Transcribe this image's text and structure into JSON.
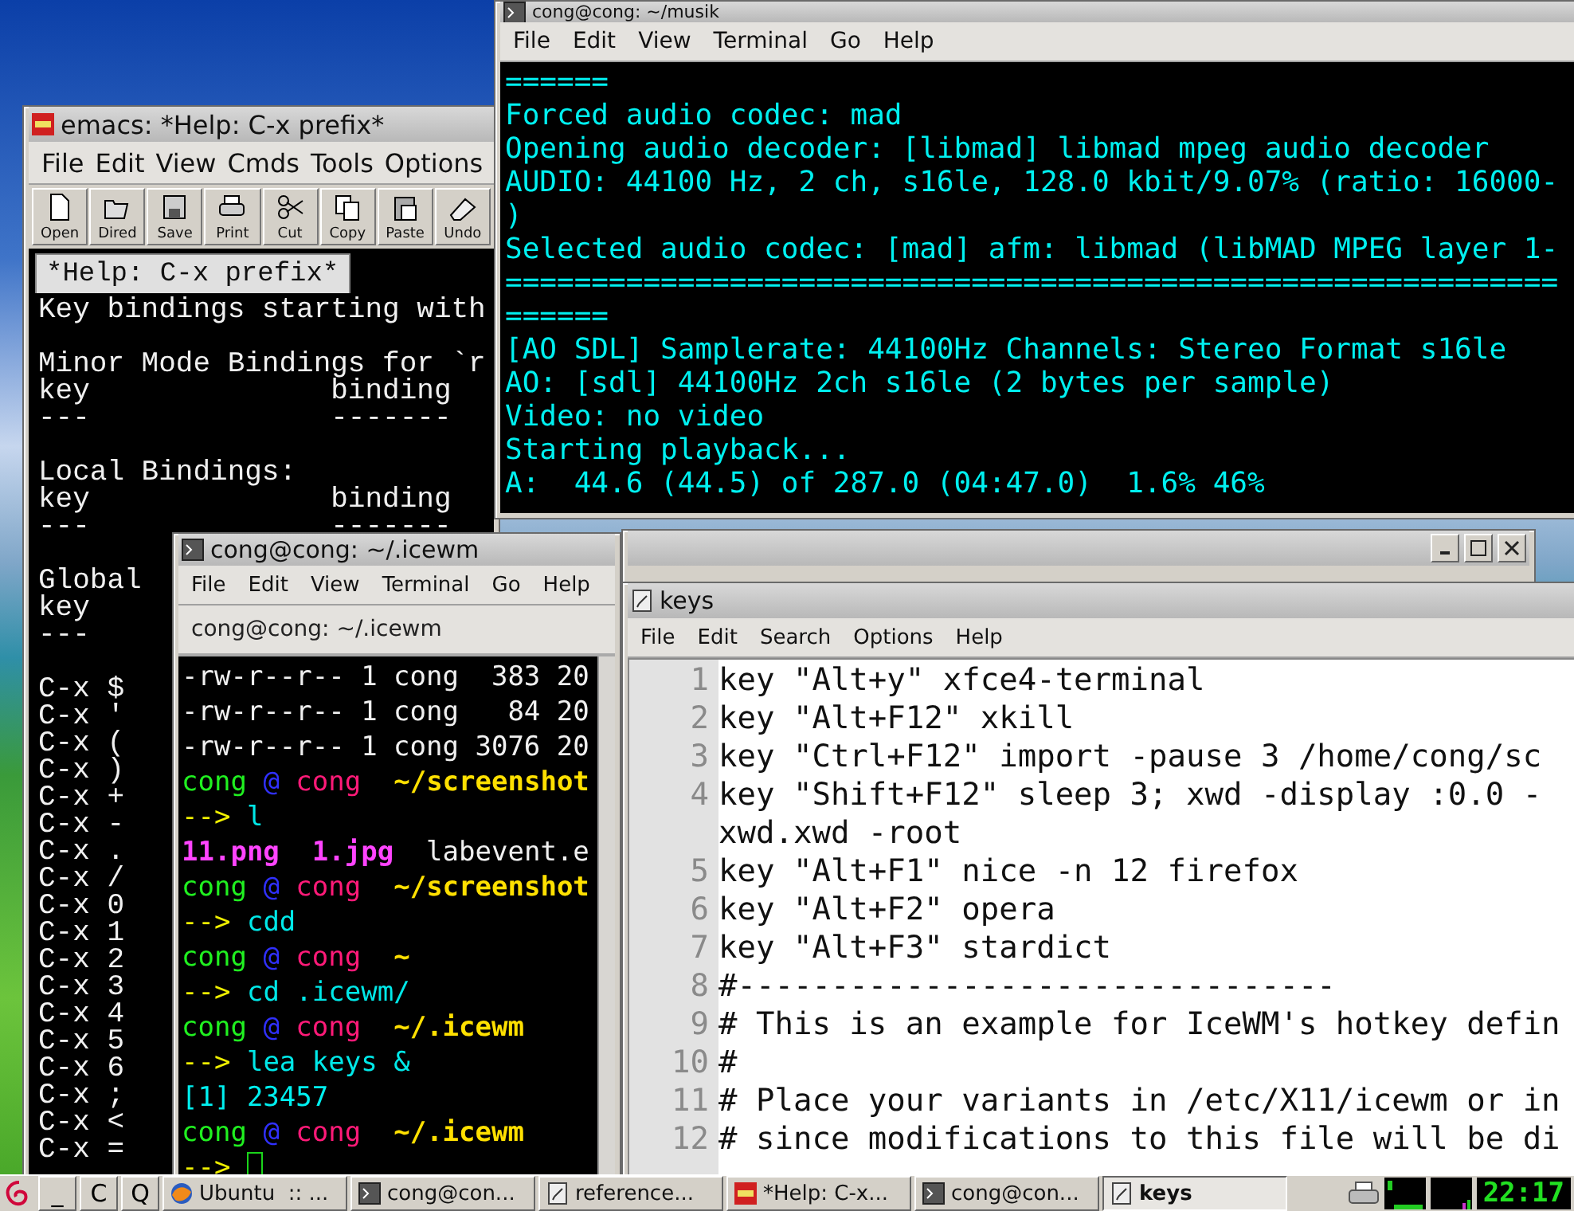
{
  "emacs_window": {
    "title": "emacs: *Help: C-x prefix*",
    "menu": [
      "File",
      "Edit",
      "View",
      "Cmds",
      "Tools",
      "Options"
    ],
    "toolbar": [
      "Open",
      "Dired",
      "Save",
      "Print",
      "Cut",
      "Copy",
      "Paste",
      "Undo"
    ],
    "tab": "*Help: C-x prefix*",
    "blocks": [
      [
        "Key bindings starting with"
      ],
      [
        "Minor Mode Bindings for `r",
        "key              binding",
        "---              -------"
      ],
      [
        "Local Bindings:",
        "key              binding",
        "---              -------"
      ],
      [
        "Global",
        "key",
        "---"
      ],
      [
        "C-x $",
        "C-x '",
        "C-x (",
        "C-x )",
        "C-x +",
        "C-x -",
        "C-x .",
        "C-x /",
        "C-x 0",
        "C-x 1",
        "C-x 2",
        "C-x 3",
        "C-x 4",
        "C-x 5",
        "C-x 6",
        "C-x ;",
        "C-x <",
        "C-x ="
      ]
    ]
  },
  "music_terminal": {
    "title": "cong@cong: ~/musik",
    "menu": [
      "File",
      "Edit",
      "View",
      "Terminal",
      "Go",
      "Help"
    ],
    "lines": [
      "======",
      "Forced audio codec: mad",
      "Opening audio decoder: [libmad] libmad mpeg audio decoder",
      "AUDIO: 44100 Hz, 2 ch, s16le, 128.0 kbit/9.07% (ratio: 16000-",
      ")",
      "Selected audio codec: [mad] afm: libmad (libMAD MPEG layer 1-",
      "=============================================================",
      "======",
      "[AO SDL] Samplerate: 44100Hz Channels: Stereo Format s16le",
      "AO: [sdl] 44100Hz 2ch s16le (2 bytes per sample)",
      "Video: no video",
      "Starting playback...",
      "A:  44.6 (44.5) of 287.0 (04:47.0)  1.6% 46%"
    ]
  },
  "icewm_terminal": {
    "title": "cong@cong: ~/.icewm",
    "menu": [
      "File",
      "Edit",
      "View",
      "Terminal",
      "Go",
      "Help"
    ],
    "tab": "cong@cong: ~/.icewm",
    "lines": [
      {
        "kind": "output",
        "text": "-rw-r--r-- 1 cong  383 20"
      },
      {
        "kind": "output",
        "text": "-rw-r--r-- 1 cong   84 20"
      },
      {
        "kind": "output",
        "text": "-rw-r--r-- 1 cong 3076 20"
      },
      {
        "kind": "prompt",
        "user": "cong",
        "at": "@",
        "host": "cong",
        "path": "~/screenshot"
      },
      {
        "kind": "command",
        "arrow": "-->",
        "command": "l"
      },
      {
        "kind": "files",
        "files": [
          {
            "text": "11.png",
            "kind": "image"
          },
          {
            "text": "1.jpg",
            "kind": "image"
          },
          {
            "text": "labevent.e",
            "kind": "plain"
          }
        ]
      },
      {
        "kind": "prompt",
        "user": "cong",
        "at": "@",
        "host": "cong",
        "path": "~/screenshot"
      },
      {
        "kind": "command",
        "arrow": "-->",
        "command": "cdd"
      },
      {
        "kind": "prompt",
        "user": "cong",
        "at": "@",
        "host": "cong",
        "path": "~"
      },
      {
        "kind": "command",
        "arrow": "-->",
        "command": "cd .icewm/"
      },
      {
        "kind": "prompt",
        "user": "cong",
        "at": "@",
        "host": "cong",
        "path": "~/.icewm"
      },
      {
        "kind": "command",
        "arrow": "-->",
        "command": "lea keys &"
      },
      {
        "kind": "job",
        "text": "[1] 23457"
      },
      {
        "kind": "prompt",
        "user": "cong",
        "at": "@",
        "host": "cong",
        "path": "~/.icewm"
      },
      {
        "kind": "command",
        "arrow": "-->",
        "cursor": true
      }
    ]
  },
  "editor_window": {
    "title": "keys",
    "menu": [
      "File",
      "Edit",
      "Search",
      "Options",
      "Help"
    ],
    "lines": [
      {
        "number": "1",
        "text": "key \"Alt+y\" xfce4-terminal"
      },
      {
        "number": "2",
        "text": "key \"Alt+F12\" xkill"
      },
      {
        "number": "3",
        "text": "key \"Ctrl+F12\" import -pause 3 /home/cong/sc"
      },
      {
        "number": "4",
        "text": "key \"Shift+F12\" sleep 3; xwd -display :0.0 -"
      },
      {
        "text": "xwd.xwd -root"
      },
      {
        "number": "5",
        "text": "key \"Alt+F1\" nice -n 12 firefox"
      },
      {
        "number": "6",
        "text": "key \"Alt+F2\" opera"
      },
      {
        "number": "7",
        "text": "key \"Alt+F3\" stardict"
      },
      {
        "number": "8",
        "text": "#--------------------------------"
      },
      {
        "number": "9",
        "text": "# This is an example for IceWM's hotkey defin"
      },
      {
        "number": "10",
        "text": "#"
      },
      {
        "number": "11",
        "text": "# Place your variants in /etc/X11/icewm or in"
      },
      {
        "number": "12",
        "text": "# since modifications to this file will be di"
      }
    ]
  },
  "taskbar": {
    "quick_buttons": [
      "_",
      "C",
      "Q"
    ],
    "tasks": [
      {
        "label": "Ubuntu  :: ...",
        "kind": "browser",
        "selected": false
      },
      {
        "label": "cong@con...",
        "kind": "terminal",
        "selected": false
      },
      {
        "label": "reference...",
        "kind": "editor",
        "selected": false
      },
      {
        "label": "*Help: C-x...",
        "kind": "emacs",
        "selected": false
      },
      {
        "label": "cong@con...",
        "kind": "terminal",
        "selected": false
      },
      {
        "label": "keys",
        "kind": "editor",
        "selected": true
      }
    ],
    "clock": "22:17"
  }
}
